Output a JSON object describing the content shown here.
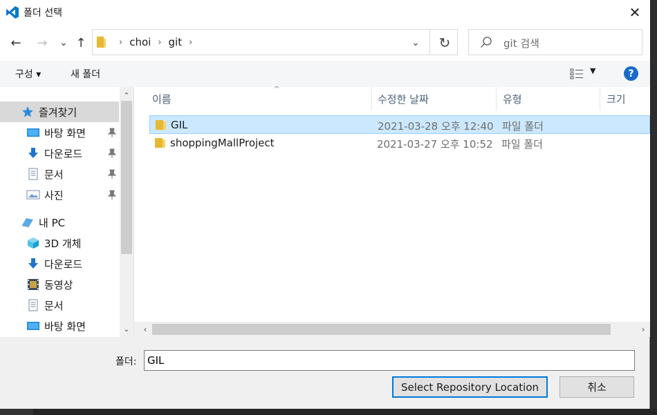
{
  "window": {
    "title": "폴더 선택",
    "close_glyph": "✕"
  },
  "nav": {
    "back_glyph": "←",
    "forward_glyph": "→",
    "recent_glyph": "⌄",
    "up_glyph": "↑",
    "breadcrumbs": [
      "choi",
      "git"
    ],
    "breadcrumb_sep": "›",
    "dropdown_glyph": "⌄",
    "refresh_glyph": "↻",
    "search_placeholder": "git 검색"
  },
  "toolbar": {
    "organize_label": "구성 ▾",
    "new_folder_label": "새 폴더",
    "view_dd_glyph": "▼",
    "help_glyph": "?"
  },
  "sidebar": {
    "items": [
      {
        "label": "즐겨찾기",
        "icon": "star-icon",
        "pinned": false
      },
      {
        "label": "바탕 화면",
        "icon": "desktop-icon",
        "pinned": true
      },
      {
        "label": "다운로드",
        "icon": "download-icon",
        "pinned": true
      },
      {
        "label": "문서",
        "icon": "document-icon",
        "pinned": true
      },
      {
        "label": "사진",
        "icon": "pictures-icon",
        "pinned": true
      },
      {
        "label": "내 PC",
        "icon": "pc-icon",
        "pinned": false
      },
      {
        "label": "3D 개체",
        "icon": "3d-objects-icon",
        "pinned": false
      },
      {
        "label": "다운로드",
        "icon": "download-icon",
        "pinned": false
      },
      {
        "label": "동영상",
        "icon": "video-icon",
        "pinned": false
      },
      {
        "label": "문서",
        "icon": "document-icon",
        "pinned": false
      },
      {
        "label": "바탕 화면",
        "icon": "desktop-icon",
        "pinned": false
      }
    ],
    "scroll_up_glyph": "⌃",
    "scroll_down_glyph": "⌄"
  },
  "files": {
    "columns": [
      "이름",
      "수정한 날짜",
      "유형",
      "크기"
    ],
    "sort_glyph": "^",
    "rows": [
      {
        "name": "GIL",
        "date": "2021-03-28 오후 12:40",
        "type": "파일 폴더",
        "selected": true
      },
      {
        "name": "shoppingMallProject",
        "date": "2021-03-27 오후 10:52",
        "type": "파일 폴더",
        "selected": false
      }
    ],
    "scroll_left_glyph": "‹",
    "scroll_right_glyph": "›"
  },
  "footer": {
    "folder_label": "폴더:",
    "folder_value": "GIL",
    "select_button": "Select Repository Location",
    "cancel_button": "취소"
  },
  "colors": {
    "accent": "#0078d7",
    "selection_bg": "#cce8ff",
    "folder": "#e8b733",
    "vscode_blue": "#0a7acc"
  }
}
